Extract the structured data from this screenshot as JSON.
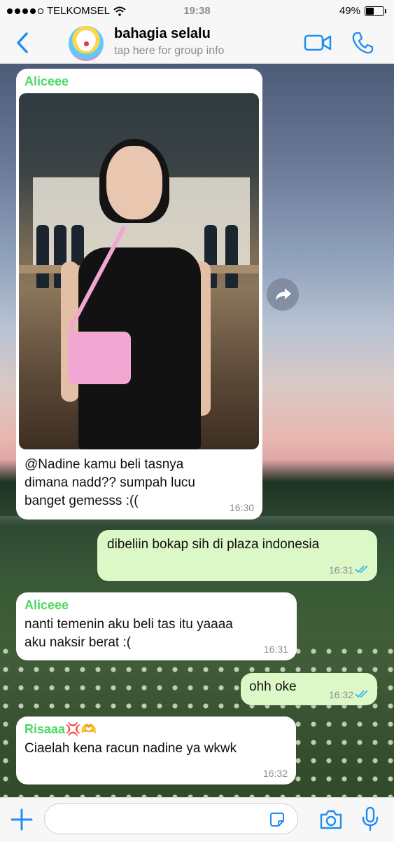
{
  "status_bar": {
    "carrier": "TELKOMSEL",
    "time": "19:38",
    "battery": "49%",
    "battery_level": 0.49,
    "signal_bars": 4
  },
  "header": {
    "back_icon": "chevron-left-icon",
    "title": "bahagia selalu",
    "subtitle": "tap here for group info",
    "accent_color": "#1f8ef1"
  },
  "messages": [
    {
      "sender": "Aliceee",
      "sender_color": "#4cd964",
      "direction": "incoming",
      "has_photo": true,
      "text_lines": [
        "@Nadine kamu beli tasnya",
        "dimana nadd?? sumpah lucu",
        "banget gemesss :(("
      ],
      "time": "16:30"
    },
    {
      "direction": "outgoing",
      "text": "dibeliin bokap sih di plaza indonesia",
      "time": "16:31",
      "read": true
    },
    {
      "sender": "Aliceee",
      "sender_color": "#4cd964",
      "direction": "incoming",
      "text_lines": [
        "nanti temenin aku beli tas itu yaaaa",
        "aku naksir berat :("
      ],
      "time": "16:31"
    },
    {
      "direction": "outgoing",
      "text": "ohh oke",
      "time": "16:32",
      "read": true
    },
    {
      "sender": "Risaaa💢🫶",
      "sender_color": "#4cd964",
      "direction": "incoming",
      "text": "Ciaelah kena racun nadine ya wkwk",
      "time": "16:32"
    }
  ],
  "input": {
    "placeholder": "",
    "value": ""
  },
  "colors": {
    "bubble_out": "#dcf8c6",
    "bubble_in": "#ffffff",
    "tick_read": "#34b7f1"
  }
}
